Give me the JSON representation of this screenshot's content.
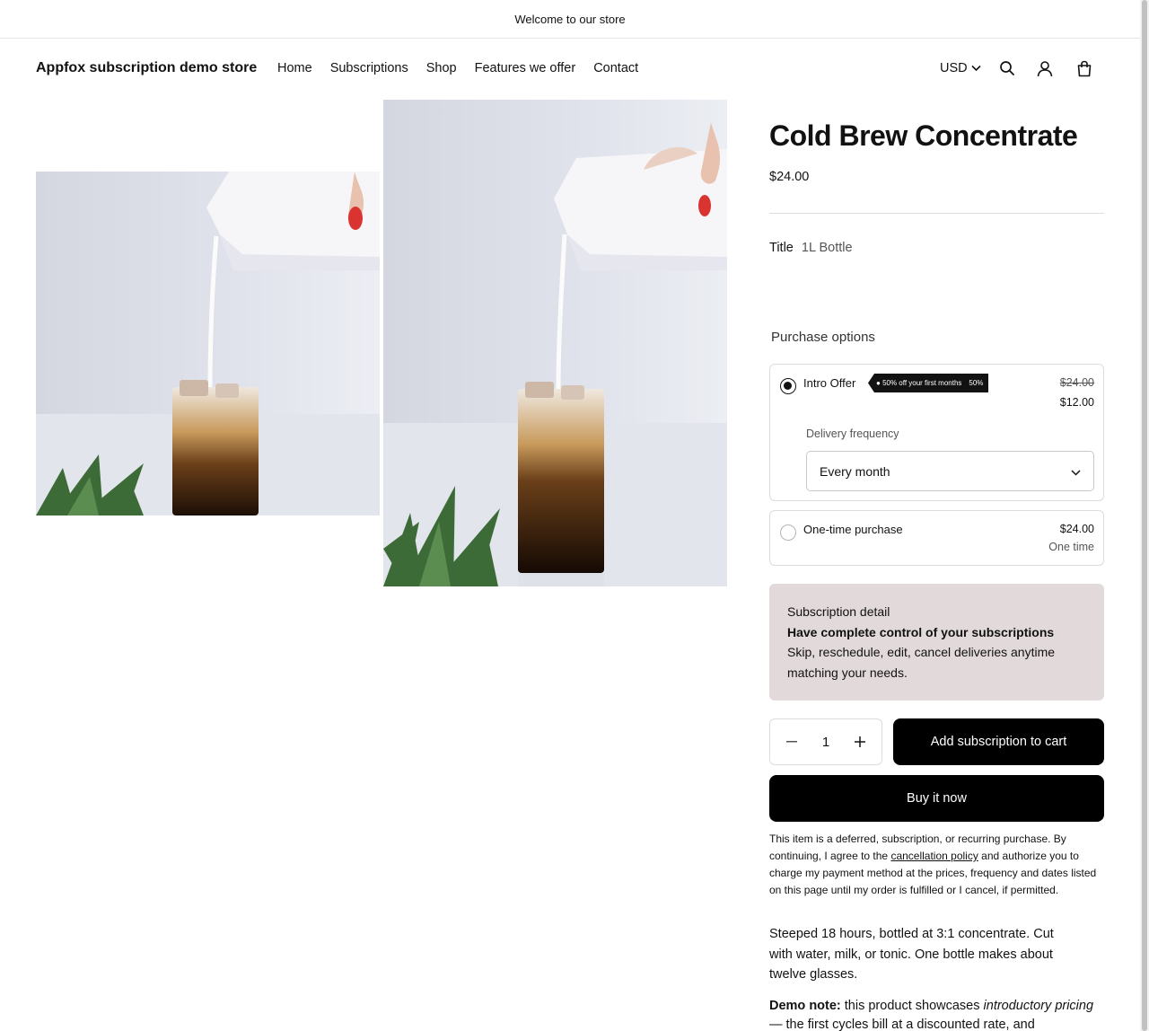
{
  "announcement": {
    "text": "Welcome to our store"
  },
  "header": {
    "logo": "Appfox subscription demo store",
    "nav": [
      "Home",
      "Subscriptions",
      "Shop",
      "Features we offer",
      "Contact"
    ],
    "currency": "USD",
    "icons": [
      "search-icon",
      "account-icon",
      "cart-icon"
    ]
  },
  "product": {
    "title": "Cold Brew Concentrate",
    "price": "$24.00",
    "variant_label": "Title",
    "variant_value": "1L Bottle",
    "purchase_options_heading": "Purchase options",
    "intro_offer": {
      "label": "Intro Offer",
      "badge_text": "50% off your first months",
      "badge_percent": "50%",
      "price_original": "$24.00",
      "price_discounted": "$12.00",
      "frequency_label": "Delivery frequency",
      "frequency_value": "Every month",
      "selected": true
    },
    "one_time": {
      "label": "One-time purchase",
      "price": "$24.00",
      "sub": "One time",
      "selected": false
    },
    "subscription_detail": {
      "heading": "Subscription detail",
      "bold": "Have complete control of your subscriptions",
      "body": "Skip, reschedule, edit, cancel deliveries anytime matching your needs."
    },
    "quantity": "1",
    "add_button": "Add subscription to cart",
    "buy_button": "Buy it now",
    "consent": {
      "before": "This item is a deferred, subscription, or recurring purchase. By continuing, I agree to the ",
      "link": "cancellation policy",
      "after": " and authorize you to charge my payment method at the prices, frequency and dates listed on this page until my order is fulfilled or I cancel, if permitted."
    },
    "description": "Steeped 18 hours, bottled at 3:1 concentrate. Cut with water, milk, or tonic. One bottle makes about twelve glasses.",
    "demo_note": {
      "label": "Demo note:",
      "text1": " this product showcases ",
      "italic": "introductory pricing",
      "text2": " — the first cycles bill at a discounted rate, and"
    }
  },
  "colors": {
    "accent": "#000000",
    "detail_bg": "#e2d9da",
    "border": "#dcdcdc"
  }
}
